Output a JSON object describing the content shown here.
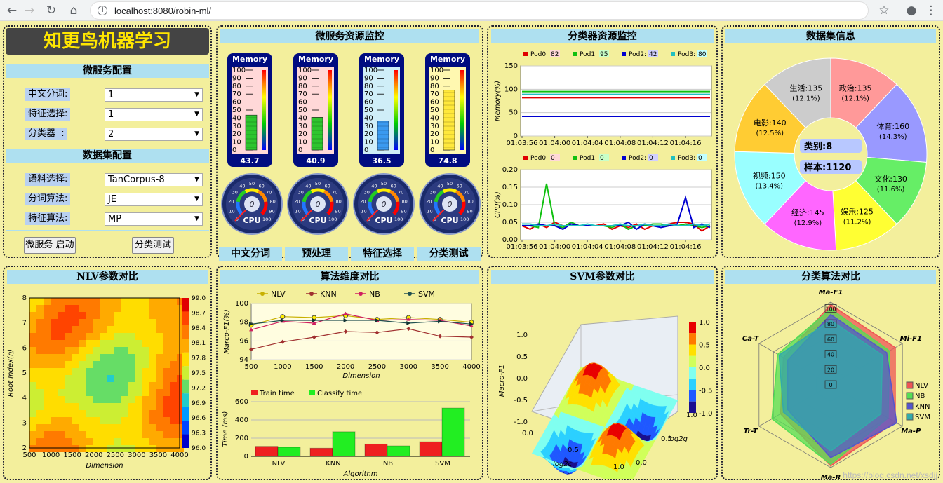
{
  "browser": {
    "url": "localhost:8080/robin-ml/"
  },
  "left": {
    "app_title": "知更鸟机器学习",
    "ms_config_title": "微服务配置",
    "ms_fields": [
      {
        "label": "中文分词:",
        "value": "1"
      },
      {
        "label": "特征选择:",
        "value": "1"
      },
      {
        "label": "分类器  :",
        "value": "2"
      }
    ],
    "ds_config_title": "数据集配置",
    "ds_fields": [
      {
        "label": "语料选择:",
        "value": "TanCorpus-8"
      },
      {
        "label": "分词算法:",
        "value": "JE"
      },
      {
        "label": "特征算法:",
        "value": "MP"
      }
    ],
    "start_button": "微服务 启动",
    "test_button": "分类测试"
  },
  "ms_monitor": {
    "title": "微服务资源监控",
    "memory_label": "Memory",
    "memory_ticks": [
      "100",
      "90",
      "80",
      "70",
      "60",
      "50",
      "40",
      "30",
      "20",
      "10",
      "0"
    ],
    "cards": [
      {
        "value": "43.7",
        "level": 43.7,
        "bg": "#ffd8d8",
        "bar": "#2ec52e"
      },
      {
        "value": "40.9",
        "level": 40.9,
        "bg": "#ffd8d8",
        "bar": "#2ec52e"
      },
      {
        "value": "36.5",
        "level": 36.5,
        "bg": "#cfeef8",
        "bar": "#3a9af0"
      },
      {
        "value": "74.8",
        "level": 74.8,
        "bg": "#fff8b0",
        "bar": "#ffe83a"
      }
    ],
    "dials": [
      {
        "label": "CPU",
        "value": "0"
      },
      {
        "label": "CPU",
        "value": "0"
      },
      {
        "label": "CPU",
        "value": "0"
      },
      {
        "label": "CPU",
        "value": "0"
      }
    ],
    "dial_ticks": [
      "0",
      "10",
      "20",
      "30",
      "40",
      "50",
      "60",
      "70",
      "80",
      "90",
      "100"
    ],
    "tabs": [
      "中文分词",
      "预处理",
      "特征选择",
      "分类测试"
    ]
  },
  "clf_monitor": {
    "title": "分类器资源监控",
    "times": [
      "01:03:56",
      "01:04:00",
      "01:04:04",
      "01:04:08",
      "01:04:12",
      "01:04:16"
    ],
    "memory": {
      "ylabel": "Memory(%)",
      "ylim": [
        0,
        150
      ],
      "yticks": [
        "0",
        "50",
        "100",
        "150"
      ],
      "legend": [
        {
          "name": "Pod0",
          "value": "82",
          "color": "#e00000",
          "bg": "#ffd8d8"
        },
        {
          "name": "Pod1",
          "value": "95",
          "color": "#10c010",
          "bg": "#c8ffc8"
        },
        {
          "name": "Pod2",
          "value": "42",
          "color": "#0000d0",
          "bg": "#d0d0ff"
        },
        {
          "name": "Pod3",
          "value": "80",
          "color": "#20c0c0",
          "bg": "#c0ffff"
        }
      ],
      "series": [
        {
          "name": "Pod0",
          "values": [
            82,
            82,
            82,
            82,
            82,
            82,
            82,
            82,
            82,
            82,
            82,
            82,
            82,
            82,
            82,
            82,
            82,
            82,
            82,
            82,
            82,
            82,
            82,
            82
          ]
        },
        {
          "name": "Pod1",
          "values": [
            95,
            95,
            95,
            95,
            95,
            95,
            95,
            95,
            95,
            95,
            95,
            95,
            95,
            95,
            95,
            95,
            95,
            95,
            95,
            95,
            95,
            95,
            95,
            95
          ]
        },
        {
          "name": "Pod2",
          "values": [
            42,
            42,
            42,
            42,
            42,
            42,
            42,
            42,
            42,
            42,
            42,
            42,
            42,
            42,
            42,
            42,
            42,
            42,
            42,
            42,
            42,
            42,
            42,
            42
          ]
        },
        {
          "name": "Pod3",
          "values": [
            89,
            89,
            89,
            89,
            89,
            89,
            89,
            89,
            89,
            89,
            89,
            89,
            89,
            89,
            89,
            89,
            89,
            89,
            89,
            89,
            89,
            89,
            89,
            89
          ]
        }
      ]
    },
    "cpu": {
      "ylabel": "CPU(%)",
      "ylim": [
        0,
        0.2
      ],
      "yticks": [
        "0.00",
        "0.05",
        "0.10",
        "0.15",
        "0.20"
      ],
      "legend": [
        {
          "name": "Pod0",
          "value": "0",
          "color": "#e00000",
          "bg": "#ffd8d8"
        },
        {
          "name": "Pod1",
          "value": "0",
          "color": "#10c010",
          "bg": "#c8ffc8"
        },
        {
          "name": "Pod2",
          "value": "0",
          "color": "#0000d0",
          "bg": "#d0d0ff"
        },
        {
          "name": "Pod3",
          "value": "0",
          "color": "#20c0c0",
          "bg": "#c0ffff"
        }
      ],
      "series": [
        {
          "name": "Pod0",
          "values": [
            0.04,
            0.03,
            0.045,
            0.035,
            0.05,
            0.04,
            0.04,
            0.04,
            0.04,
            0.04,
            0.045,
            0.03,
            0.04,
            0.035,
            0.045,
            0.03,
            0.04,
            0.04,
            0.045,
            0.05,
            0.05,
            0.045,
            0.025,
            0.04
          ]
        },
        {
          "name": "Pod1",
          "values": [
            0.04,
            0.04,
            0.035,
            0.16,
            0.04,
            0.035,
            0.05,
            0.04,
            0.04,
            0.04,
            0.04,
            0.035,
            0.045,
            0.03,
            0.04,
            0.04,
            0.045,
            0.045,
            0.04,
            0.04,
            0.045,
            0.04,
            0.035,
            0.04
          ]
        },
        {
          "name": "Pod2",
          "values": [
            0.04,
            0.04,
            0.045,
            0.04,
            0.04,
            0.03,
            0.045,
            0.04,
            0.04,
            0.04,
            0.04,
            0.04,
            0.04,
            0.05,
            0.03,
            0.045,
            0.04,
            0.035,
            0.04,
            0.045,
            0.12,
            0.035,
            0.045,
            0.035
          ]
        },
        {
          "name": "Pod3",
          "values": [
            0.045,
            0.045,
            0.04,
            0.04,
            0.045,
            0.04,
            0.04,
            0.04,
            0.045,
            0.04,
            0.04,
            0.04,
            0.045,
            0.04,
            0.04,
            0.045,
            0.04,
            0.04,
            0.045,
            0.04,
            0.04,
            0.045,
            0.04,
            0.045
          ]
        }
      ]
    }
  },
  "dataset": {
    "title": "数据集信息",
    "center_category": "类别:8",
    "center_samples": "样本:1120",
    "chart_data": {
      "type": "pie",
      "slices": [
        {
          "name": "政治",
          "value": 135,
          "pct": "(12.1%)",
          "color": "#ff9999"
        },
        {
          "name": "体育",
          "value": 160,
          "pct": "(14.3%)",
          "color": "#9999ff"
        },
        {
          "name": "文化",
          "value": 130,
          "pct": "(11.6%)",
          "color": "#66ee66"
        },
        {
          "name": "娱乐",
          "value": 125,
          "pct": "(11.2%)",
          "color": "#ffff33"
        },
        {
          "name": "经济",
          "value": 145,
          "pct": "(12.9%)",
          "color": "#ff66ff"
        },
        {
          "name": "视频",
          "value": 150,
          "pct": "(13.4%)",
          "color": "#99ffff"
        },
        {
          "name": "电影",
          "value": 140,
          "pct": "(12.5%)",
          "color": "#ffcc33"
        },
        {
          "name": "生活",
          "value": 135,
          "pct": "(12.1%)",
          "color": "#cccccc"
        }
      ]
    }
  },
  "nlv": {
    "title": "NLV参数对比",
    "xlabel": "Dimension",
    "ylabel": "Root Index(η)",
    "xticks": [
      "500",
      "1000",
      "1500",
      "2000",
      "2500",
      "3000",
      "3500",
      "4000"
    ],
    "yticks": [
      "2",
      "3",
      "4",
      "5",
      "6",
      "7",
      "8"
    ],
    "colorbar": [
      "99.0",
      "98.7",
      "98.4",
      "98.1",
      "97.8",
      "97.5",
      "97.2",
      "96.9",
      "96.6",
      "96.3",
      "96.0"
    ],
    "colors": [
      "#e00000",
      "#ff4400",
      "#ff7a00",
      "#ffaa00",
      "#ffdd00",
      "#ccee33",
      "#66dd66",
      "#22cccc",
      "#0099ff",
      "#0044ff",
      "#0000cc"
    ]
  },
  "algo": {
    "title": "算法维度对比",
    "line_chart": {
      "type": "line",
      "xlabel": "Dimension",
      "ylabel": "Marco-F1(%)",
      "x": [
        500,
        1000,
        1500,
        2000,
        2500,
        3000,
        3500,
        4000
      ],
      "ylim": [
        94,
        100
      ],
      "yticks": [
        "94",
        "96",
        "98",
        "100"
      ],
      "series": [
        {
          "name": "NLV",
          "color": "#c8b000",
          "marker": "circle",
          "values": [
            97.7,
            98.6,
            98.5,
            98.7,
            98.3,
            98.5,
            98.3,
            98.0
          ]
        },
        {
          "name": "KNN",
          "color": "#a03030",
          "marker": "diamond",
          "values": [
            95.1,
            95.9,
            96.4,
            97.0,
            96.9,
            97.3,
            96.5,
            96.4
          ]
        },
        {
          "name": "NB",
          "color": "#d02060",
          "marker": "triangle",
          "values": [
            97.2,
            98.1,
            97.9,
            98.9,
            98.2,
            98.3,
            98.2,
            97.6
          ]
        },
        {
          "name": "SVM",
          "color": "#205050",
          "marker": "arrow",
          "values": [
            97.8,
            98.2,
            98.2,
            98.2,
            98.2,
            97.9,
            98.1,
            97.8
          ]
        }
      ]
    },
    "bar_chart": {
      "type": "bar",
      "xlabel": "Algorithm",
      "ylabel": "Time (ms)",
      "ylim": [
        0,
        600
      ],
      "yticks": [
        "0",
        "200",
        "400",
        "600"
      ],
      "categories": [
        "NLV",
        "KNN",
        "NB",
        "SVM"
      ],
      "series": [
        {
          "name": "Train time",
          "color": "#ee2020",
          "values": [
            110,
            90,
            135,
            160
          ]
        },
        {
          "name": "Classify time",
          "color": "#22ee22",
          "values": [
            100,
            270,
            115,
            530
          ]
        }
      ]
    }
  },
  "svm": {
    "title": "SVM参数对比",
    "zlabel": "Macro-F1",
    "xlabel": "log2c",
    "ylabel": "log2g",
    "zticks": [
      "1.0",
      "0.5",
      "0.0",
      "-0.5",
      "-1.0"
    ],
    "xticks": [
      "0.0",
      "0.5",
      "1.0"
    ],
    "yticks": [
      "0.0",
      "0.5",
      "1.0"
    ],
    "colorbar": [
      "1.0",
      "0.5",
      "0.0",
      "-0.5",
      "-1.0"
    ]
  },
  "radar": {
    "title": "分类算法对比",
    "chart_data": {
      "type": "radar",
      "axes": [
        "Ma-F1",
        "Mi-F1",
        "Ma-P",
        "Ma-R",
        "Tr-T",
        "Ca-T"
      ],
      "ticks": [
        "100",
        "80",
        "60",
        "40",
        "20",
        "0"
      ],
      "series": [
        {
          "name": "NLV",
          "color": "#ee5555",
          "values": [
            97,
            90,
            90,
            98,
            70,
            66
          ]
        },
        {
          "name": "NB",
          "color": "#55dd55",
          "values": [
            92,
            82,
            80,
            96,
            82,
            74
          ]
        },
        {
          "name": "KNN",
          "color": "#5555cc",
          "values": [
            85,
            78,
            92,
            88,
            60,
            60
          ]
        },
        {
          "name": "SVM",
          "color": "#33aaaa",
          "values": [
            78,
            72,
            70,
            80,
            66,
            72
          ]
        }
      ]
    }
  },
  "watermark": "https://blog.csdn.net/xsdjj"
}
